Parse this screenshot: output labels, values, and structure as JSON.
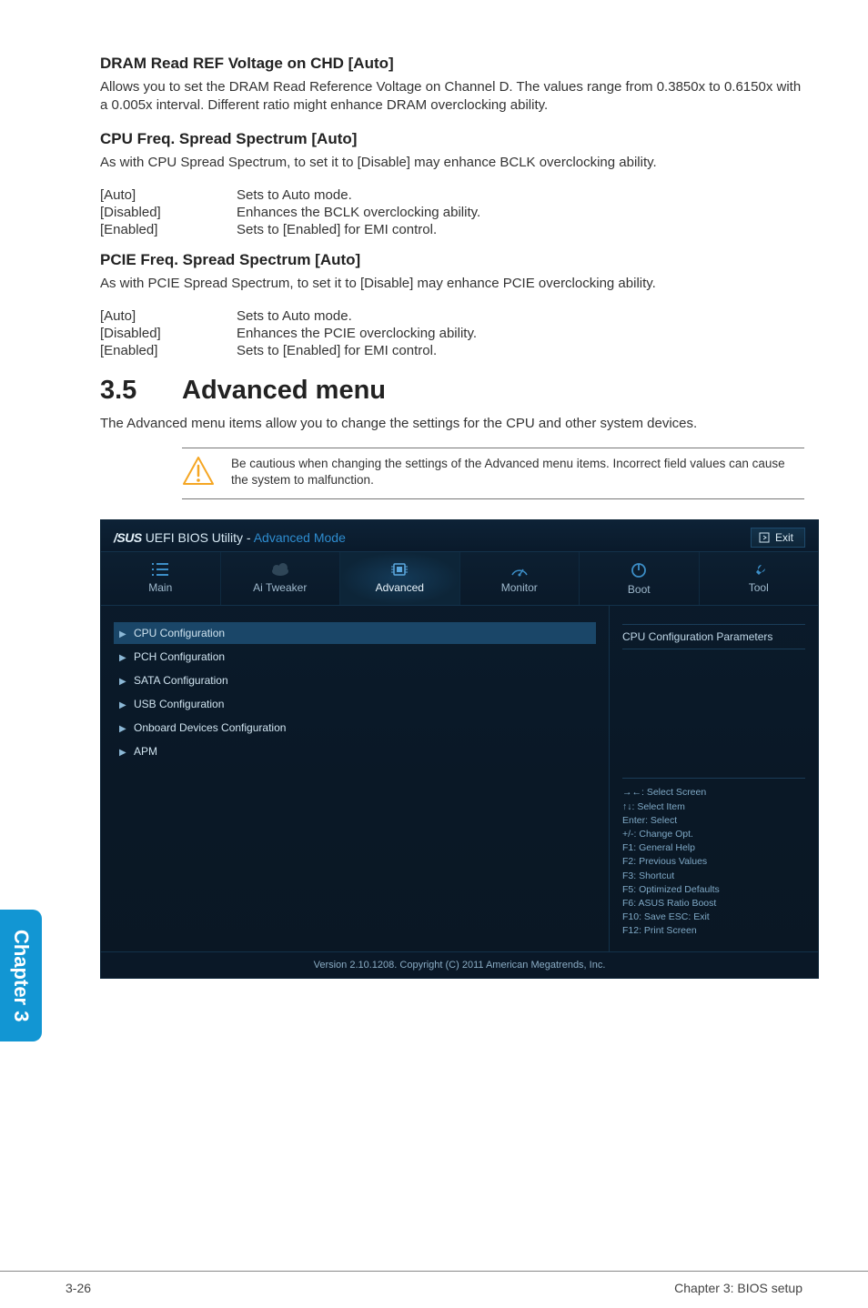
{
  "sections": {
    "dram": {
      "heading": "DRAM Read REF Voltage on CHD [Auto]",
      "body": "Allows you to set the DRAM Read Reference Voltage on Channel D. The values range from 0.3850x to 0.6150x with a 0.005x interval. Different ratio might enhance DRAM overclocking ability."
    },
    "cpu_spread": {
      "heading": "CPU Freq. Spread Spectrum [Auto]",
      "body": "As with CPU Spread Spectrum, to set it to [Disable] may enhance BCLK overclocking ability.",
      "opts": [
        {
          "k": "[Auto]",
          "v": "Sets to Auto mode."
        },
        {
          "k": "[Disabled]",
          "v": "Enhances the BCLK overclocking ability."
        },
        {
          "k": "[Enabled]",
          "v": "Sets to [Enabled] for EMI control."
        }
      ]
    },
    "pcie_spread": {
      "heading": "PCIE Freq. Spread Spectrum [Auto]",
      "body": "As with PCIE Spread Spectrum, to set it to [Disable] may enhance PCIE overclocking ability.",
      "opts": [
        {
          "k": "[Auto]",
          "v": "Sets to Auto mode."
        },
        {
          "k": "[Disabled]",
          "v": "Enhances the PCIE overclocking ability."
        },
        {
          "k": "[Enabled]",
          "v": "Sets to [Enabled] for EMI control."
        }
      ]
    },
    "advanced": {
      "num": "3.5",
      "title": "Advanced menu",
      "body": "The Advanced menu items allow you to change the settings for the CPU and other system devices.",
      "note": "Be cautious when changing the settings of the Advanced menu items. Incorrect field values can cause the system to malfunction."
    }
  },
  "bios": {
    "brand": "/SUS",
    "title_rest": "UEFI BIOS Utility - ",
    "title_mode": "Advanced Mode",
    "exit": "Exit",
    "tabs": [
      "Main",
      "Ai Tweaker",
      "Advanced",
      "Monitor",
      "Boot",
      "Tool"
    ],
    "active_tab": 2,
    "left_items": [
      "CPU Configuration",
      "PCH Configuration",
      "SATA Configuration",
      "USB Configuration",
      "Onboard Devices Configuration",
      "APM"
    ],
    "selected_item": 0,
    "help_title": "CPU Configuration Parameters",
    "help_keys": [
      "→←: Select Screen",
      "↑↓: Select Item",
      "Enter: Select",
      "+/-: Change Opt.",
      "F1: General Help",
      "F2: Previous Values",
      "F3: Shortcut",
      "F5: Optimized Defaults",
      "F6: ASUS Ratio Boost",
      "F10: Save   ESC: Exit",
      "F12: Print Screen"
    ],
    "footer": "Version 2.10.1208.  Copyright (C) 2011 American Megatrends, Inc."
  },
  "side_tab": "Chapter 3",
  "page_footer": {
    "left": "3-26",
    "right": "Chapter 3: BIOS setup"
  }
}
